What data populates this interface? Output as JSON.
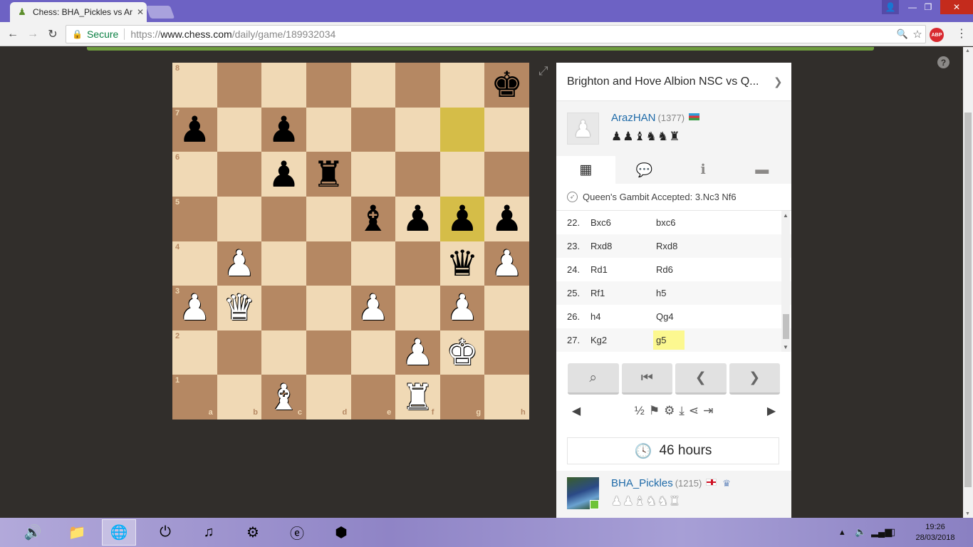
{
  "browser": {
    "tab_title": "Chess: BHA_Pickles vs Ar",
    "tab_close": "✕",
    "secure_label": "Secure",
    "url_scheme": "https://",
    "url_host": "www.chess.com",
    "url_path": "/daily/game/189932034",
    "abp_label": "ABP"
  },
  "board": {
    "files": [
      "a",
      "b",
      "c",
      "d",
      "e",
      "f",
      "g",
      "h"
    ],
    "ranks": [
      "8",
      "7",
      "6",
      "5",
      "4",
      "3",
      "2",
      "1"
    ],
    "highlight": [
      "g7",
      "g5"
    ],
    "pieces": [
      {
        "sq": "h8",
        "color": "b",
        "glyph": "♚"
      },
      {
        "sq": "a7",
        "color": "b",
        "glyph": "♟"
      },
      {
        "sq": "c7",
        "color": "b",
        "glyph": "♟"
      },
      {
        "sq": "c6",
        "color": "b",
        "glyph": "♟"
      },
      {
        "sq": "d6",
        "color": "b",
        "glyph": "♜"
      },
      {
        "sq": "e5",
        "color": "b",
        "glyph": "♝"
      },
      {
        "sq": "f5",
        "color": "b",
        "glyph": "♟"
      },
      {
        "sq": "g5",
        "color": "b",
        "glyph": "♟"
      },
      {
        "sq": "h5",
        "color": "b",
        "glyph": "♟"
      },
      {
        "sq": "b4",
        "color": "w",
        "glyph": "♟"
      },
      {
        "sq": "g4",
        "color": "b",
        "glyph": "♛"
      },
      {
        "sq": "h4",
        "color": "w",
        "glyph": "♟"
      },
      {
        "sq": "a3",
        "color": "w",
        "glyph": "♟"
      },
      {
        "sq": "b3",
        "color": "w",
        "glyph": "♛"
      },
      {
        "sq": "e3",
        "color": "w",
        "glyph": "♟"
      },
      {
        "sq": "g3",
        "color": "w",
        "glyph": "♟"
      },
      {
        "sq": "f2",
        "color": "w",
        "glyph": "♟"
      },
      {
        "sq": "g2",
        "color": "w",
        "glyph": "♚"
      },
      {
        "sq": "c1",
        "color": "w",
        "glyph": "♝"
      },
      {
        "sq": "f1",
        "color": "w",
        "glyph": "♜"
      }
    ]
  },
  "panel": {
    "header": "Brighton and Hove Albion NSC vs Q...",
    "top_player": {
      "name": "ArazHAN",
      "rating": "(1377)",
      "captured": "♟♟♝♞♞♜"
    },
    "opening": "Queen's Gambit Accepted: 3.Nc3 Nf6",
    "moves": [
      {
        "n": "22.",
        "w": "Bxc6",
        "b": "bxc6"
      },
      {
        "n": "23.",
        "w": "Rxd8",
        "b": "Rxd8"
      },
      {
        "n": "24.",
        "w": "Rd1",
        "b": "Rd6"
      },
      {
        "n": "25.",
        "w": "Rf1",
        "b": "h5"
      },
      {
        "n": "26.",
        "w": "h4",
        "b": "Qg4"
      },
      {
        "n": "27.",
        "w": "Kg2",
        "b": "g5"
      }
    ],
    "current_move": "g5",
    "draw_label": "½",
    "timer": "46 hours",
    "bottom_player": {
      "name": "BHA_Pickles",
      "rating": "(1215)",
      "captured": "♟♟♝♞♞♜"
    }
  },
  "taskbar": {
    "time": "19:26",
    "date": "28/03/2018"
  }
}
